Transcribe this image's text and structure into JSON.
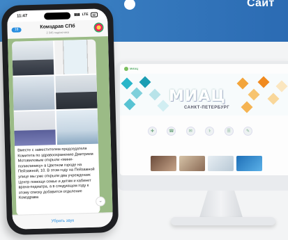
{
  "banner": {
    "title": "Сайт"
  },
  "phone": {
    "status_time": "11:47",
    "status_network": "LTE",
    "battery": "62",
    "chat": {
      "back_count": "18",
      "title": "Комздрав СПб",
      "subtitle": "2 345 подписчика"
    },
    "message_text": "Вместе с заместителем председателя Комитета по здравоохранению Дмитрием Мотовиловым открыли «мини-поликлинику» в Цветном городе на Пейзажной, 10. В этом году на Пейзажной улице мы уже открыли два учреждения: Центр помощи семье и детям и кабинет врача-педиатра, а в следующем году к этому списку добавится отделение Комздрава",
    "mute_label": "Убрать звук",
    "scroll_icon": "chevron-down-icon"
  },
  "website": {
    "hero_title": "МИАЦ",
    "hero_subtitle": "САНКТ-ПЕТЕРБУРГ",
    "logo_text": "МИАЦ"
  },
  "colors": {
    "banner": "#2b6bb3",
    "accent_blue": "#2a8fe0",
    "chat_bg": "#9bbb86"
  }
}
